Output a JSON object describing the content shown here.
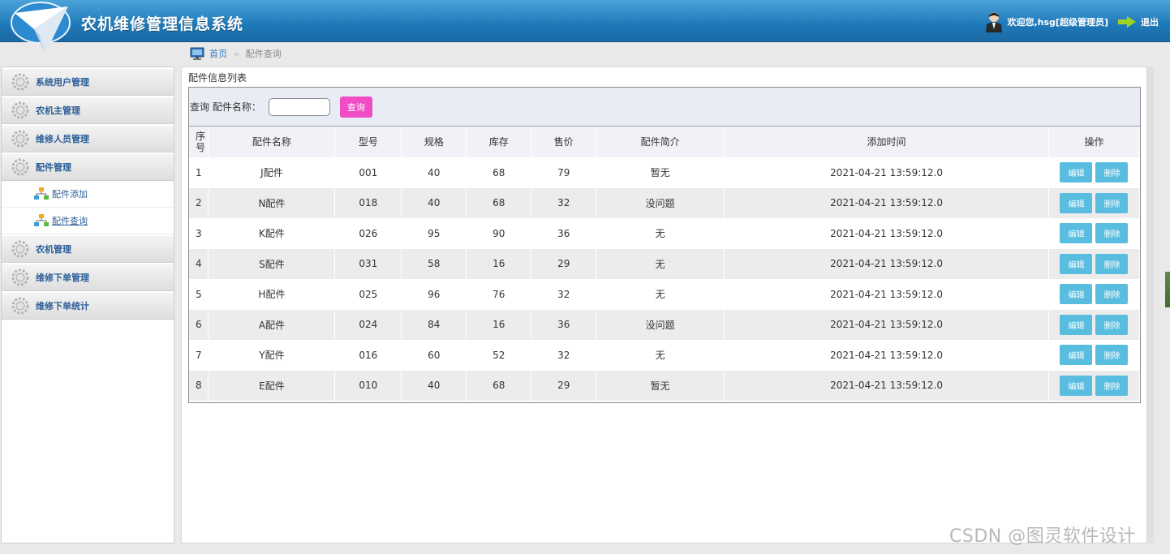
{
  "app": {
    "title": "农机维修管理信息系统",
    "welcome": "欢迎您,hsg[超级管理员]",
    "logout": "退出"
  },
  "breadcrumb": {
    "home": "首页",
    "sep": "»",
    "current": "配件查询"
  },
  "sidebar": {
    "items": [
      {
        "label": "系统用户管理"
      },
      {
        "label": "农机主管理"
      },
      {
        "label": "维修人员管理"
      },
      {
        "label": "配件管理"
      },
      {
        "label": "农机管理"
      },
      {
        "label": "维修下单管理"
      },
      {
        "label": "维修下单统计"
      }
    ],
    "subitems": [
      {
        "label": "配件添加"
      },
      {
        "label": "配件查询"
      }
    ]
  },
  "main": {
    "list_title": "配件信息列表",
    "search_label": "查询 配件名称：",
    "search_value": "",
    "search_button": "查询",
    "columns": [
      "序号",
      "配件名称",
      "型号",
      "规格",
      "库存",
      "售价",
      "配件简介",
      "添加时间",
      "操作"
    ],
    "rows": [
      [
        "1",
        "J配件",
        "001",
        "40",
        "68",
        "79",
        "暂无",
        "2021-04-21 13:59:12.0"
      ],
      [
        "2",
        "N配件",
        "018",
        "40",
        "68",
        "32",
        "没问题",
        "2021-04-21 13:59:12.0"
      ],
      [
        "3",
        "K配件",
        "026",
        "95",
        "90",
        "36",
        "无",
        "2021-04-21 13:59:12.0"
      ],
      [
        "4",
        "S配件",
        "031",
        "58",
        "16",
        "29",
        "无",
        "2021-04-21 13:59:12.0"
      ],
      [
        "5",
        "H配件",
        "025",
        "96",
        "76",
        "32",
        "无",
        "2021-04-21 13:59:12.0"
      ],
      [
        "6",
        "A配件",
        "024",
        "84",
        "16",
        "36",
        "没问题",
        "2021-04-21 13:59:12.0"
      ],
      [
        "7",
        "Y配件",
        "016",
        "60",
        "52",
        "32",
        "无",
        "2021-04-21 13:59:12.0"
      ],
      [
        "8",
        "E配件",
        "010",
        "40",
        "68",
        "29",
        "暂无",
        "2021-04-21 13:59:12.0"
      ]
    ],
    "edit_label": "编辑",
    "delete_label": "删除"
  },
  "watermark": "CSDN @图灵软件设计",
  "colors": {
    "header": "#1f79b8",
    "search_button": "#f04cc5",
    "op_button": "#59bde0",
    "menu_text": "#2b5e97"
  }
}
